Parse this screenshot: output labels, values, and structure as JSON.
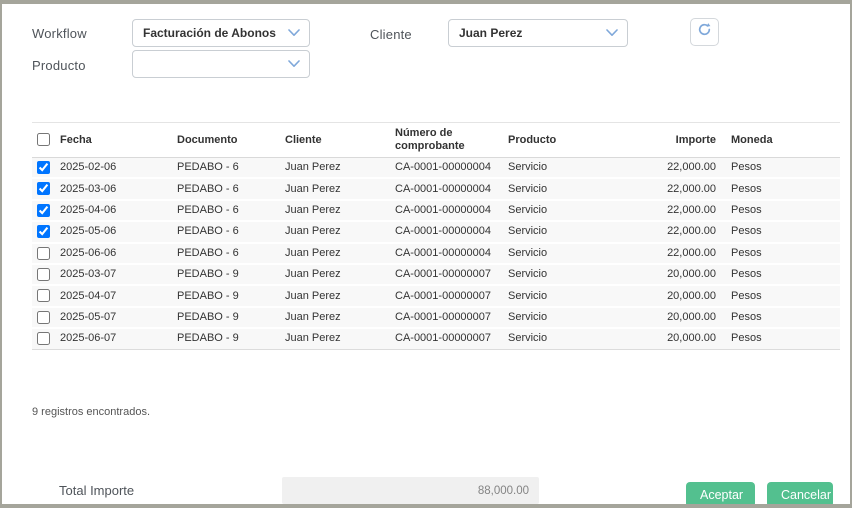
{
  "filters": {
    "workflow": {
      "label": "Workflow",
      "value": "Facturación de Abonos"
    },
    "cliente": {
      "label": "Cliente",
      "value": "Juan Perez"
    },
    "producto": {
      "label": "Producto",
      "value": ""
    }
  },
  "toolbar": {
    "refresh_icon": "refresh"
  },
  "table": {
    "columns": [
      "Fecha",
      "Documento",
      "Cliente",
      "Número de comprobante",
      "Producto",
      "Importe",
      "Moneda"
    ],
    "rows": [
      {
        "checked": true,
        "fecha": "2025-02-06",
        "documento": "PEDABO - 6",
        "cliente": "Juan Perez",
        "comprobante": "CA-0001-00000004",
        "producto": "Servicio",
        "importe": "22,000.00",
        "moneda": "Pesos"
      },
      {
        "checked": true,
        "fecha": "2025-03-06",
        "documento": "PEDABO - 6",
        "cliente": "Juan Perez",
        "comprobante": "CA-0001-00000004",
        "producto": "Servicio",
        "importe": "22,000.00",
        "moneda": "Pesos"
      },
      {
        "checked": true,
        "fecha": "2025-04-06",
        "documento": "PEDABO - 6",
        "cliente": "Juan Perez",
        "comprobante": "CA-0001-00000004",
        "producto": "Servicio",
        "importe": "22,000.00",
        "moneda": "Pesos"
      },
      {
        "checked": true,
        "fecha": "2025-05-06",
        "documento": "PEDABO - 6",
        "cliente": "Juan Perez",
        "comprobante": "CA-0001-00000004",
        "producto": "Servicio",
        "importe": "22,000.00",
        "moneda": "Pesos"
      },
      {
        "checked": false,
        "fecha": "2025-06-06",
        "documento": "PEDABO - 6",
        "cliente": "Juan Perez",
        "comprobante": "CA-0001-00000004",
        "producto": "Servicio",
        "importe": "22,000.00",
        "moneda": "Pesos"
      },
      {
        "checked": false,
        "fecha": "2025-03-07",
        "documento": "PEDABO - 9",
        "cliente": "Juan Perez",
        "comprobante": "CA-0001-00000007",
        "producto": "Servicio",
        "importe": "20,000.00",
        "moneda": "Pesos"
      },
      {
        "checked": false,
        "fecha": "2025-04-07",
        "documento": "PEDABO - 9",
        "cliente": "Juan Perez",
        "comprobante": "CA-0001-00000007",
        "producto": "Servicio",
        "importe": "20,000.00",
        "moneda": "Pesos"
      },
      {
        "checked": false,
        "fecha": "2025-05-07",
        "documento": "PEDABO - 9",
        "cliente": "Juan Perez",
        "comprobante": "CA-0001-00000007",
        "producto": "Servicio",
        "importe": "20,000.00",
        "moneda": "Pesos"
      },
      {
        "checked": false,
        "fecha": "2025-06-07",
        "documento": "PEDABO - 9",
        "cliente": "Juan Perez",
        "comprobante": "CA-0001-00000007",
        "producto": "Servicio",
        "importe": "20,000.00",
        "moneda": "Pesos"
      }
    ]
  },
  "summary": {
    "records_text": "9 registros encontrados."
  },
  "footer": {
    "total_label": "Total Importe",
    "total_value": "88,000.00",
    "accept_label": "Aceptar",
    "cancel_label": "Cancelar"
  },
  "colors": {
    "accent_green": "#53c08f",
    "icon_blue": "#6f9fd8",
    "frame_gray": "#a5a59b",
    "row_gray": "#f8f8f8"
  }
}
